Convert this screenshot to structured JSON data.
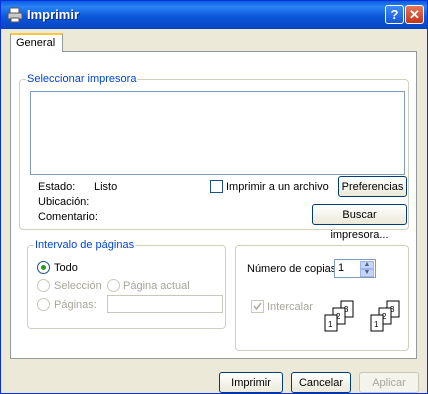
{
  "window": {
    "title": "Imprimir",
    "help_label": "?",
    "close_label": "✕"
  },
  "tabs": [
    {
      "label": "General"
    }
  ],
  "printer_group": {
    "legend": "Seleccionar impresora",
    "status_label": "Estado:",
    "status_value": "Listo",
    "location_label": "Ubicación:",
    "comment_label": "Comentario:",
    "print_to_file_label": "Imprimir a un archivo",
    "preferences_button": "Preferencias",
    "find_printer_button": "Buscar impresora..."
  },
  "range_group": {
    "legend": "Intervalo de páginas",
    "all_label": "Todo",
    "selection_label": "Selección",
    "current_page_label": "Página actual",
    "pages_label": "Páginas:",
    "pages_value": ""
  },
  "copies_group": {
    "copies_label": "Número de copias:",
    "copies_value": "1",
    "collate_label": "Intercalar"
  },
  "footer": {
    "print_button": "Imprimir",
    "cancel_button": "Cancelar",
    "apply_button": "Aplicar"
  },
  "colors": {
    "title_blue": "#0a5ce6",
    "group_legend": "#0046d5",
    "dialog_bg": "#ece9d8"
  }
}
